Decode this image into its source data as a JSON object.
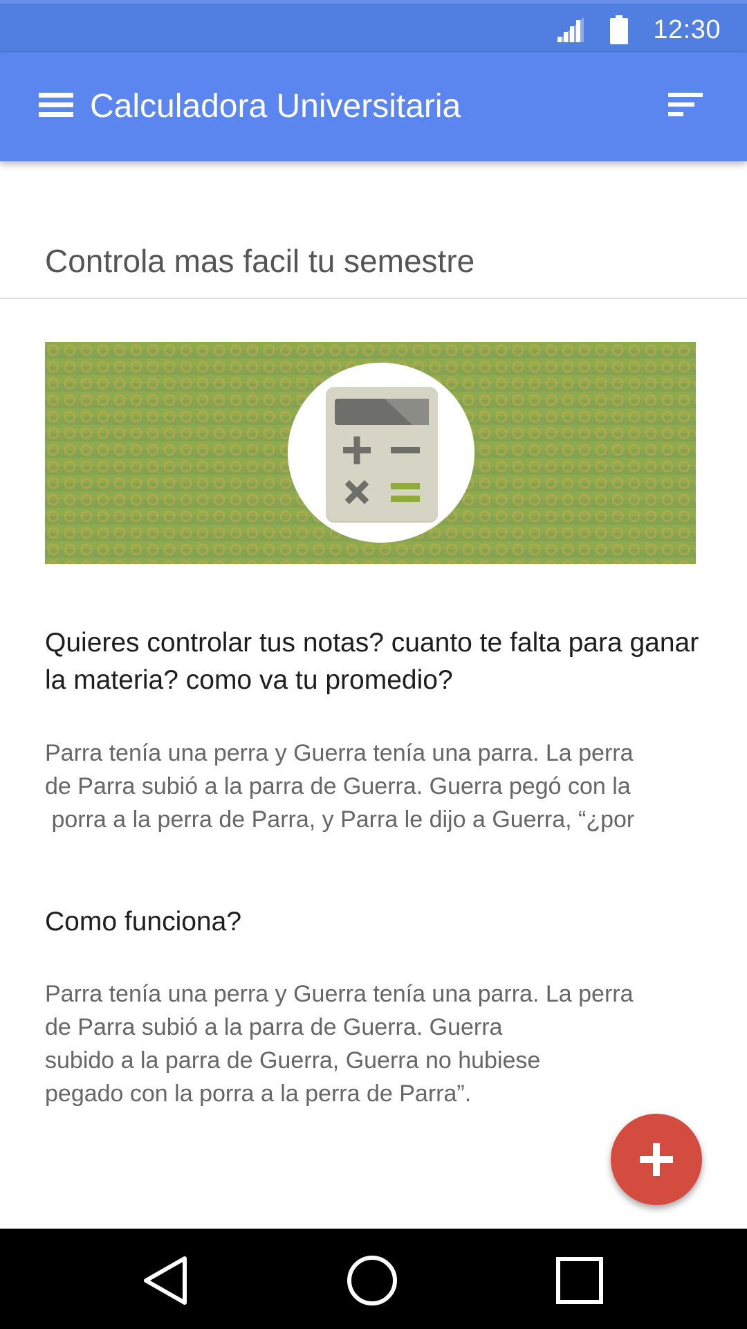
{
  "status_bar": {
    "time": "12:30",
    "icons": [
      "signal-icon",
      "battery-icon"
    ]
  },
  "app_bar": {
    "title": "Calculadora Universitaria",
    "menu_icon": "hamburger-menu-icon",
    "sort_icon": "sort-icon",
    "background": "#5b86ef",
    "status_background": "#517ee1"
  },
  "main": {
    "section_title": "Controla mas facil tu semestre",
    "banner": {
      "icon": "calculator-icon",
      "background": "#8fab4e"
    },
    "heading_1": "Quieres controlar tus notas? cuanto te falta para ganar la materia? como va tu promedio?",
    "paragraph_1": {
      "line_1": "Parra tenía una perra y Guerra tenía una parra. La perra",
      "line_2": "de Parra subió a la parra de Guerra. Guerra pegó con la",
      "line_3": " porra a la perra de Parra, y Parra le dijo a Guerra, “¿por"
    },
    "heading_2": "Como funciona?",
    "paragraph_2": {
      "line_1": "Parra tenía una perra y Guerra tenía una parra. La perra",
      "line_2": "de Parra subió a la parra de Guerra. Guerra",
      "line_3": "subido a la parra de Guerra, Guerra no hubiese",
      "line_4": "pegado con la porra a la perra de Parra”."
    }
  },
  "fab": {
    "icon": "plus-icon",
    "color": "#d44b3f"
  },
  "nav_bar": {
    "buttons": [
      "back-icon",
      "home-icon",
      "recents-icon"
    ]
  }
}
